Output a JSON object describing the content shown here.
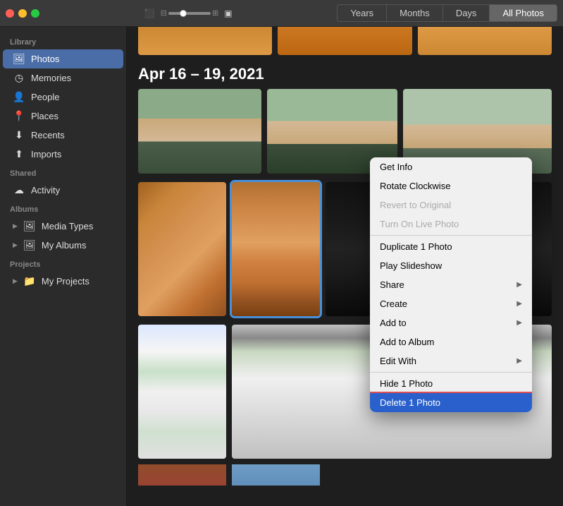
{
  "titlebar": {
    "traffic_lights": [
      "red",
      "yellow",
      "green"
    ],
    "slider_label": "slider"
  },
  "view_tabs": [
    {
      "id": "years",
      "label": "Years"
    },
    {
      "id": "months",
      "label": "Months"
    },
    {
      "id": "days",
      "label": "Days"
    },
    {
      "id": "all_photos",
      "label": "All Photos",
      "active": true
    }
  ],
  "sidebar": {
    "sections": [
      {
        "label": "Library",
        "items": [
          {
            "id": "photos",
            "icon": "🖼",
            "label": "Photos",
            "active": true
          },
          {
            "id": "memories",
            "icon": "◷",
            "label": "Memories"
          },
          {
            "id": "people",
            "icon": "👤",
            "label": "People"
          },
          {
            "id": "places",
            "icon": "📍",
            "label": "Places"
          },
          {
            "id": "recents",
            "icon": "⬇",
            "label": "Recents"
          },
          {
            "id": "imports",
            "icon": "⬆",
            "label": "Imports"
          }
        ]
      },
      {
        "label": "Shared",
        "items": [
          {
            "id": "activity",
            "icon": "☁",
            "label": "Activity"
          }
        ]
      },
      {
        "label": "Albums",
        "items": [
          {
            "id": "media-types",
            "icon": "▸",
            "label": "Media Types",
            "has_arrow": true
          },
          {
            "id": "my-albums",
            "icon": "▸",
            "label": "My Albums",
            "has_arrow": true
          }
        ]
      },
      {
        "label": "Projects",
        "items": [
          {
            "id": "my-projects",
            "icon": "▸",
            "label": "My Projects",
            "has_arrow": true
          }
        ]
      }
    ]
  },
  "content": {
    "date_range": "Apr 16 – 19, 2021"
  },
  "context_menu": {
    "items": [
      {
        "id": "get-info",
        "label": "Get Info",
        "disabled": false
      },
      {
        "id": "rotate",
        "label": "Rotate Clockwise",
        "disabled": false
      },
      {
        "id": "revert",
        "label": "Revert to Original",
        "disabled": true
      },
      {
        "id": "live-photo",
        "label": "Turn On Live Photo",
        "disabled": true
      },
      {
        "separator": true
      },
      {
        "id": "duplicate",
        "label": "Duplicate 1 Photo",
        "disabled": false
      },
      {
        "id": "slideshow",
        "label": "Play Slideshow",
        "disabled": false
      },
      {
        "id": "share",
        "label": "Share",
        "disabled": false,
        "has_arrow": true
      },
      {
        "id": "create",
        "label": "Create",
        "disabled": false,
        "has_arrow": true
      },
      {
        "id": "add-to",
        "label": "Add to",
        "disabled": false,
        "has_arrow": true
      },
      {
        "id": "add-to-album",
        "label": "Add to Album",
        "disabled": false
      },
      {
        "id": "edit-with",
        "label": "Edit With",
        "disabled": false,
        "has_arrow": true
      },
      {
        "separator": true
      },
      {
        "id": "hide",
        "label": "Hide 1 Photo",
        "disabled": false
      },
      {
        "id": "delete",
        "label": "Delete 1 Photo",
        "disabled": false,
        "highlighted": true
      }
    ]
  }
}
